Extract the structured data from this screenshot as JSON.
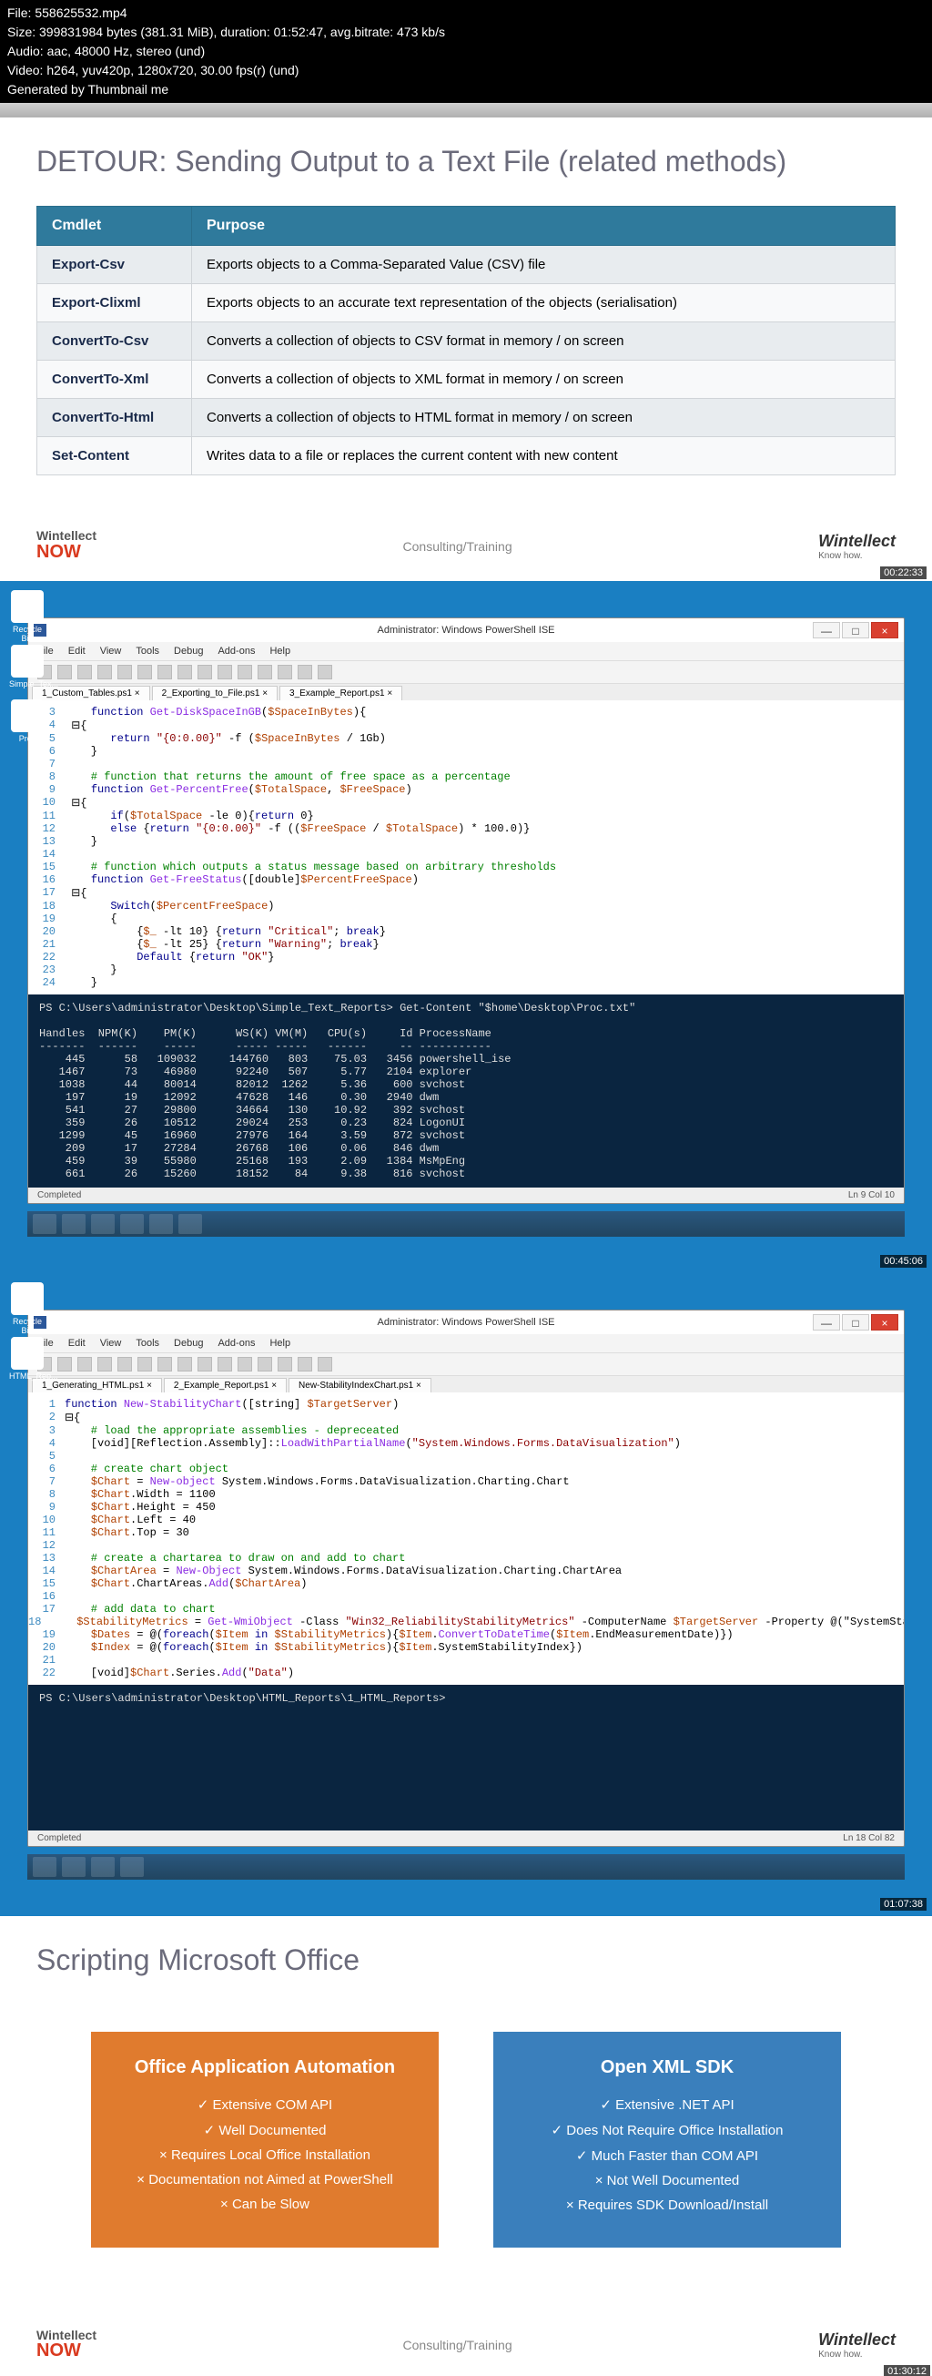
{
  "meta": {
    "file": "File: 558625532.mp4",
    "size": "Size: 399831984 bytes (381.31 MiB), duration: 01:52:47, avg.bitrate: 473 kb/s",
    "audio": "Audio: aac, 48000 Hz, stereo (und)",
    "video": "Video: h264, yuv420p, 1280x720, 30.00 fps(r) (und)",
    "gen": "Generated by Thumbnail me"
  },
  "slide1": {
    "title": "DETOUR: Sending Output to a Text File (related methods)",
    "headers": [
      "Cmdlet",
      "Purpose"
    ],
    "rows": [
      [
        "Export-Csv",
        "Exports objects to a Comma-Separated Value (CSV) file"
      ],
      [
        "Export-Clixml",
        "Exports objects to an accurate text representation of the objects (serialisation)"
      ],
      [
        "ConvertTo-Csv",
        "Converts a collection of objects to CSV format in memory / on screen"
      ],
      [
        "ConvertTo-Xml",
        "Converts a collection of objects to XML format in memory / on screen"
      ],
      [
        "ConvertTo-Html",
        "Converts a collection of objects to HTML format in memory / on screen"
      ],
      [
        "Set-Content",
        "Writes data to a file or replaces the current content with new content"
      ]
    ]
  },
  "footer": {
    "logo1": "Wintellect",
    "logo2": "NOW",
    "center": "Consulting/Training",
    "right": "Wintellect",
    "tag": "Know how."
  },
  "ise": {
    "title": "Administrator: Windows PowerShell ISE",
    "menu": [
      "File",
      "Edit",
      "View",
      "Tools",
      "Debug",
      "Add-ons",
      "Help"
    ],
    "tabs1": [
      "1_Custom_Tables.ps1",
      "2_Exporting_to_File.ps1",
      "3_Example_Report.ps1"
    ],
    "tabs2": [
      "1_Generating_HTML.ps1",
      "2_Example_Report.ps1",
      "New-StabilityIndexChart.ps1"
    ],
    "code1": [
      {
        "n": "3",
        "t": "    function Get-DiskSpaceInGB($SpaceInBytes){",
        "cls": ""
      },
      {
        "n": "4",
        "t": " ⊟{",
        "cls": ""
      },
      {
        "n": "5",
        "t": "       return \"{0:0.00}\" -f ($SpaceInBytes / 1Gb)",
        "cls": ""
      },
      {
        "n": "6",
        "t": "    }",
        "cls": ""
      },
      {
        "n": "7",
        "t": "",
        "cls": ""
      },
      {
        "n": "8",
        "t": "    # function that returns the amount of free space as a percentage",
        "cls": "cm"
      },
      {
        "n": "9",
        "t": "    function Get-PercentFree($TotalSpace, $FreeSpace)",
        "cls": ""
      },
      {
        "n": "10",
        "t": " ⊟{",
        "cls": ""
      },
      {
        "n": "11",
        "t": "       if($TotalSpace -le 0){return 0}",
        "cls": ""
      },
      {
        "n": "12",
        "t": "       else {return \"{0:0.00}\" -f (($FreeSpace / $TotalSpace) * 100.0)}",
        "cls": ""
      },
      {
        "n": "13",
        "t": "    }",
        "cls": ""
      },
      {
        "n": "14",
        "t": "",
        "cls": ""
      },
      {
        "n": "15",
        "t": "    # function which outputs a status message based on arbitrary thresholds",
        "cls": "cm"
      },
      {
        "n": "16",
        "t": "    function Get-FreeStatus([double]$PercentFreeSpace)",
        "cls": ""
      },
      {
        "n": "17",
        "t": " ⊟{",
        "cls": ""
      },
      {
        "n": "18",
        "t": "       Switch($PercentFreeSpace)",
        "cls": ""
      },
      {
        "n": "19",
        "t": "       {",
        "cls": ""
      },
      {
        "n": "20",
        "t": "           {$_ -lt 10} {return \"Critical\"; break}",
        "cls": ""
      },
      {
        "n": "21",
        "t": "           {$_ -lt 25} {return \"Warning\"; break}",
        "cls": ""
      },
      {
        "n": "22",
        "t": "           Default {return \"OK\"}",
        "cls": ""
      },
      {
        "n": "23",
        "t": "       }",
        "cls": ""
      },
      {
        "n": "24",
        "t": "    }",
        "cls": ""
      }
    ],
    "console1": "PS C:\\Users\\administrator\\Desktop\\Simple_Text_Reports> Get-Content \"$home\\Desktop\\Proc.txt\"\n\nHandles  NPM(K)    PM(K)      WS(K) VM(M)   CPU(s)     Id ProcessName\n-------  ------    -----      ----- -----   ------     -- -----------\n    445      58   109032     144760   803    75.03   3456 powershell_ise\n   1467      73    46980      92240   507     5.77   2104 explorer\n   1038      44    80014      82012  1262     5.36    600 svchost\n    197      19    12092      47628   146     0.30   2940 dwm\n    541      27    29800      34664   130    10.92    392 svchost\n    359      26    10512      29024   253     0.23    824 LogonUI\n   1299      45    16960      27976   164     3.59    872 svchost\n    209      17    27284      26768   106     0.06    846 dwm\n    459      39    55980      25168   193     2.09   1384 MsMpEng\n    661      26    15260      18152    84     9.38    816 svchost",
    "status1": "Ln 9 Col 10",
    "completed": "Completed",
    "code2": [
      {
        "n": "1",
        "t": "function New-StabilityChart([string] $TargetServer)",
        "cls": ""
      },
      {
        "n": "2",
        "t": "⊟{",
        "cls": ""
      },
      {
        "n": "3",
        "t": "    # load the appropriate assemblies - depreceated",
        "cls": "cm"
      },
      {
        "n": "4",
        "t": "    [void][Reflection.Assembly]::LoadWithPartialName(\"System.Windows.Forms.DataVisualization\")",
        "cls": ""
      },
      {
        "n": "5",
        "t": "",
        "cls": ""
      },
      {
        "n": "6",
        "t": "    # create chart object",
        "cls": "cm"
      },
      {
        "n": "7",
        "t": "    $Chart = New-object System.Windows.Forms.DataVisualization.Charting.Chart",
        "cls": ""
      },
      {
        "n": "8",
        "t": "    $Chart.Width = 1100",
        "cls": ""
      },
      {
        "n": "9",
        "t": "    $Chart.Height = 450",
        "cls": ""
      },
      {
        "n": "10",
        "t": "    $Chart.Left = 40",
        "cls": ""
      },
      {
        "n": "11",
        "t": "    $Chart.Top = 30",
        "cls": ""
      },
      {
        "n": "12",
        "t": "",
        "cls": ""
      },
      {
        "n": "13",
        "t": "    # create a chartarea to draw on and add to chart",
        "cls": "cm"
      },
      {
        "n": "14",
        "t": "    $ChartArea = New-Object System.Windows.Forms.DataVisualization.Charting.ChartArea",
        "cls": ""
      },
      {
        "n": "15",
        "t": "    $Chart.ChartAreas.Add($ChartArea)",
        "cls": ""
      },
      {
        "n": "16",
        "t": "",
        "cls": ""
      },
      {
        "n": "17",
        "t": "    # add data to chart",
        "cls": "cm"
      },
      {
        "n": "18",
        "t": "    $StabilityMetrics = Get-WmiObject -Class \"Win32_ReliabilityStabilityMetrics\" -ComputerName $TargetServer -Property @(\"SystemStabilityI",
        "cls": ""
      },
      {
        "n": "19",
        "t": "    $Dates = @(foreach($Item in $StabilityMetrics){$Item.ConvertToDateTime($Item.EndMeasurementDate)})",
        "cls": ""
      },
      {
        "n": "20",
        "t": "    $Index = @(foreach($Item in $StabilityMetrics){$Item.SystemStabilityIndex})",
        "cls": ""
      },
      {
        "n": "21",
        "t": "",
        "cls": ""
      },
      {
        "n": "22",
        "t": "    [void]$Chart.Series.Add(\"Data\")",
        "cls": ""
      }
    ],
    "console2": "PS C:\\Users\\administrator\\Desktop\\HTML_Reports\\1_HTML_Reports>",
    "status2": "Ln 18 Col 82"
  },
  "desktop_icons": [
    "Recycle Bin",
    "Simple_Tex...",
    "Proc"
  ],
  "desktop_icons2": [
    "Recycle Bin",
    "HTML_Rep..."
  ],
  "timestamps": [
    "00:22:33",
    "00:45:06",
    "01:07:38",
    "01:30:12"
  ],
  "slide2": {
    "title": "Scripting Microsoft Office",
    "col1": {
      "title": "Office Application Automation",
      "items": [
        {
          "t": "Extensive COM API",
          "c": "check"
        },
        {
          "t": "Well Documented",
          "c": "check"
        },
        {
          "t": "Requires Local Office Installation",
          "c": "cross"
        },
        {
          "t": "Documentation not Aimed at PowerShell",
          "c": "cross"
        },
        {
          "t": "Can be Slow",
          "c": "cross"
        }
      ]
    },
    "col2": {
      "title": "Open XML SDK",
      "items": [
        {
          "t": "Extensive .NET API",
          "c": "check"
        },
        {
          "t": "Does Not Require Office Installation",
          "c": "check"
        },
        {
          "t": "Much Faster than COM API",
          "c": "check"
        },
        {
          "t": "Not Well Documented",
          "c": "cross"
        },
        {
          "t": "Requires SDK Download/Install",
          "c": "cross"
        }
      ]
    }
  }
}
